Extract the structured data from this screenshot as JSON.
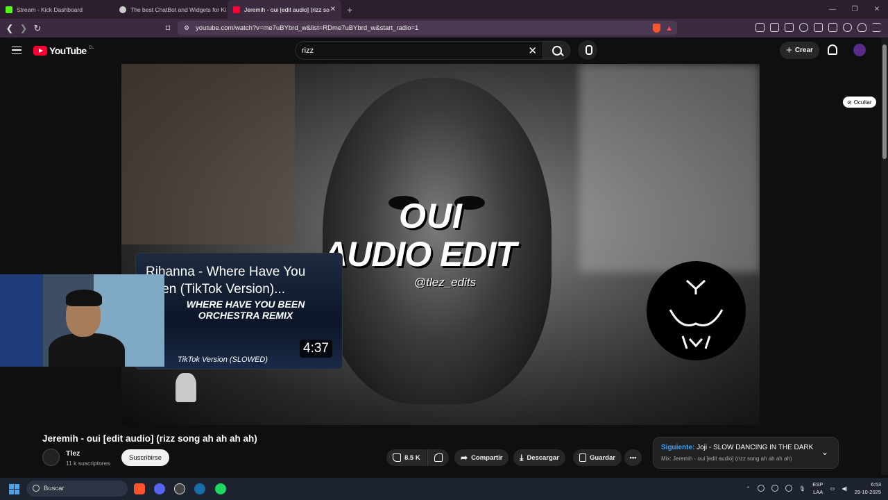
{
  "browser": {
    "tabs": [
      {
        "label": "Stream - Kick Dashboard",
        "favicon_color": "#53fc18"
      },
      {
        "label": "The best ChatBot and Widgets for Ki",
        "favicon_color": "#cccccc"
      },
      {
        "label": "Jeremih - oui [edit audio] (rizz so",
        "favicon_color": "#ff0033"
      }
    ],
    "new_tab": "+",
    "url": "youtube.com/watch?v=me7uBYbrd_w&list=RDme7uBYbrd_w&start_radio=1"
  },
  "youtube": {
    "logo_text": "YouTube",
    "region": "CL",
    "search_value": "rizz",
    "create_label": "Crear"
  },
  "video": {
    "overlay_line1": "OUI",
    "overlay_line2": "AUDIO EDIT",
    "overlay_handle": "@tlez_edits",
    "hide_label": "Ocultar",
    "title": "Jeremih - oui [edit audio] (rizz song ah ah ah ah)",
    "channel": "Tlez",
    "subscribers": "11 k suscriptores",
    "subscribe_label": "Suscribirse",
    "likes": "8.5 K",
    "share_label": "Compartir",
    "download_label": "Descargar",
    "save_label": "Guardar"
  },
  "popup": {
    "title": "Rihanna - Where Have You Been (TikTok Version)...",
    "subtitle": "WHERE HAVE YOU BEEN ORCHESTRA REMIX",
    "caption": "TikTok Version (SLOWED)",
    "duration": "4:37"
  },
  "next_card": {
    "prefix": "Siguiente:",
    "title": "Joji - SLOW DANCING IN THE DARK",
    "mix": "Mix: Jeremih - oui [edit audio] (rizz song ah ah ah ah)"
  },
  "taskbar": {
    "search_label": "Buscar",
    "lang_top": "ESP",
    "lang_bottom": "LAA",
    "time": "6:53",
    "date": "29-10-2025"
  }
}
